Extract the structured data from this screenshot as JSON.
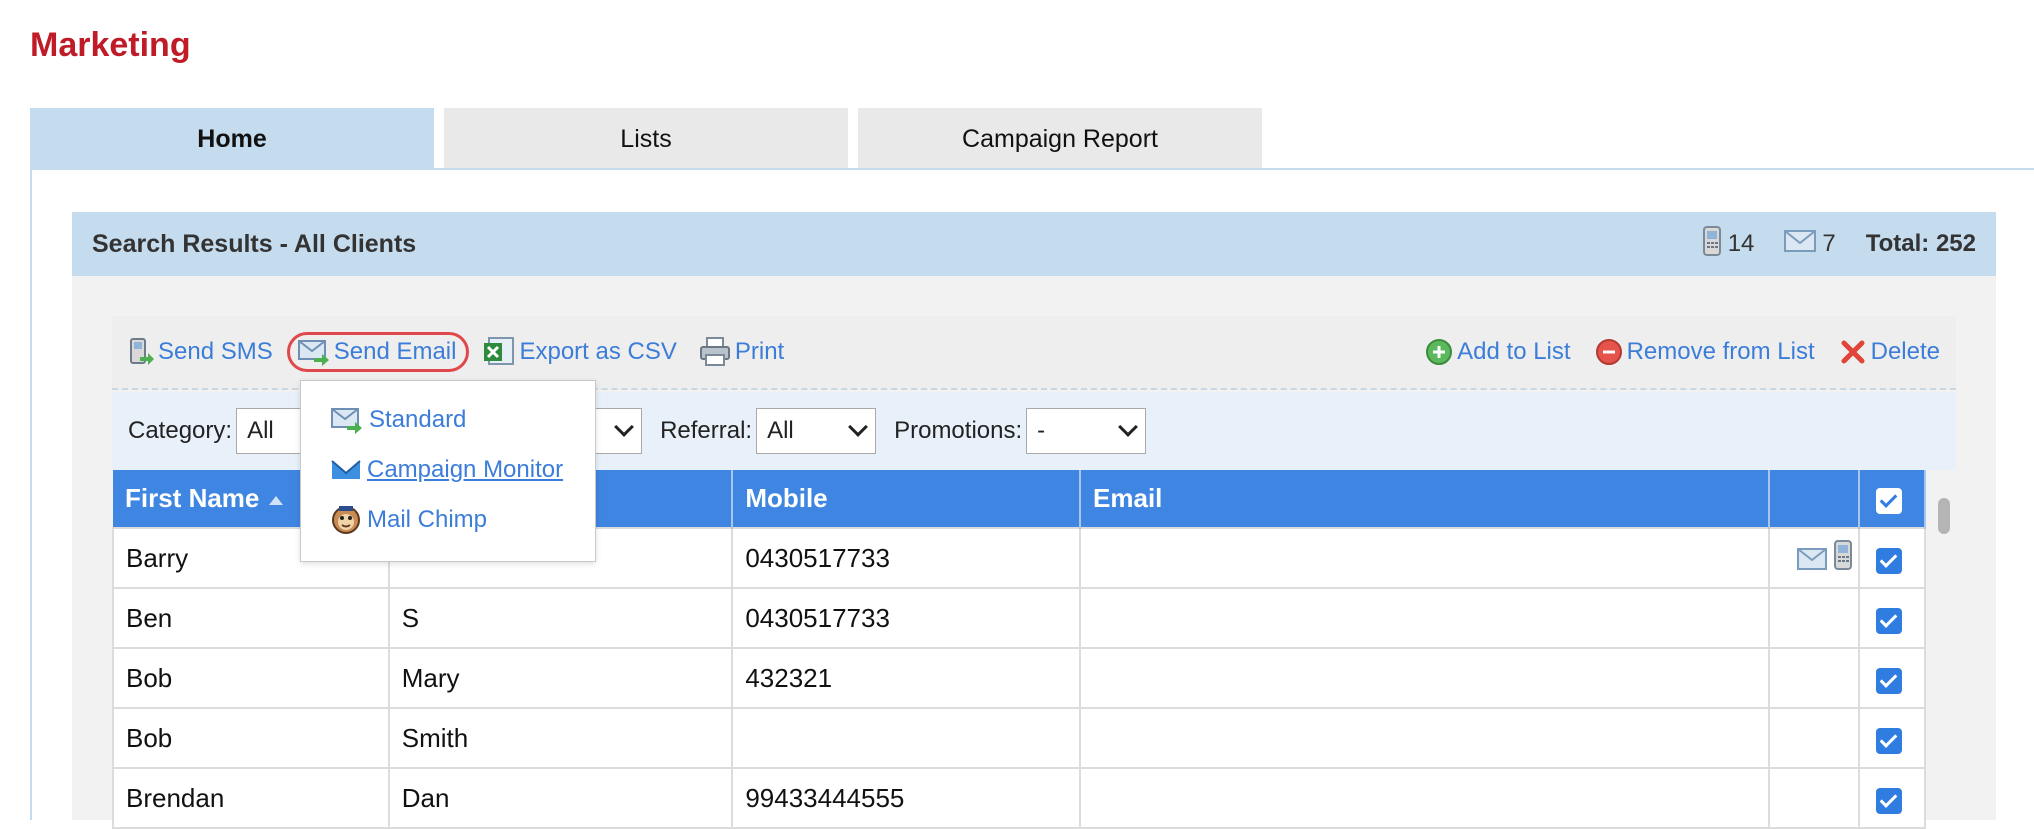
{
  "page_title": "Marketing",
  "tabs": [
    {
      "label": "Home",
      "active": true
    },
    {
      "label": "Lists",
      "active": false
    },
    {
      "label": "Campaign Report",
      "active": false
    }
  ],
  "results": {
    "title": "Search Results - All Clients",
    "mobile_count": "14",
    "email_count": "7",
    "total_label": "Total: 252"
  },
  "toolbar": {
    "send_sms": "Send SMS",
    "send_email": "Send Email",
    "export_csv": "Export as CSV",
    "print": "Print",
    "add_to_list": "Add to List",
    "remove_from_list": "Remove from List",
    "delete": "Delete"
  },
  "email_menu": {
    "standard": "Standard",
    "campaign_monitor": "Campaign Monitor",
    "mail_chimp": "Mail Chimp"
  },
  "filters": {
    "category_label": "Category:",
    "category_value": "All",
    "referral_label": "Referral:",
    "referral_value": "All",
    "promotions_label": "Promotions:",
    "promotions_value": "-"
  },
  "table": {
    "headers": {
      "first_name": "First Name",
      "last_name": "",
      "mobile": "Mobile",
      "email": "Email"
    },
    "rows": [
      {
        "first": "Barry",
        "last": "",
        "mobile": "0430517733",
        "email": "",
        "icons": true
      },
      {
        "first": "Ben",
        "last": "S",
        "mobile": "0430517733",
        "email": "",
        "icons": false
      },
      {
        "first": "Bob",
        "last": "Mary",
        "mobile": "432321",
        "email": "",
        "icons": false
      },
      {
        "first": "Bob",
        "last": "Smith",
        "mobile": "",
        "email": "",
        "icons": false
      },
      {
        "first": "Brendan",
        "last": "Dan",
        "mobile": "99433444555",
        "email": "",
        "icons": false
      }
    ]
  },
  "colors": {
    "title_red": "#c01c28",
    "header_blue": "#3f86e2",
    "link_blue": "#3b7dd8",
    "panel_blue": "#c5dbee",
    "highlight_red": "#e0484c"
  }
}
